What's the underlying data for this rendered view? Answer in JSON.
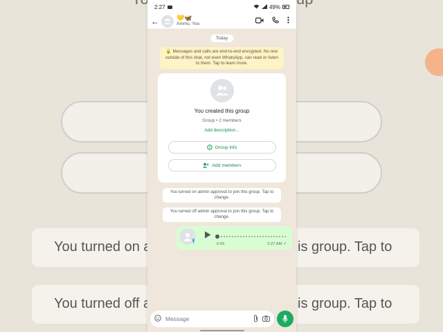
{
  "backdrop": {
    "top_fragment": "You",
    "top_fragment2": "up",
    "line1_left": "You turned on a",
    "line1_right": "is group. Tap to",
    "line2_left": "You turned off a",
    "line2_right": "is group. Tap to"
  },
  "status_bar": {
    "time": "2:27",
    "battery": "49%"
  },
  "header": {
    "title": "💛🦋",
    "subtitle": "Ammu, You"
  },
  "chat": {
    "date_chip": "Today",
    "encryption_note": "🔒 Messages and calls are end-to-end encrypted. No one outside of this chat, not even WhatsApp, can read or listen to them. Tap to learn more.",
    "group_card": {
      "created": "You created this group",
      "members": "Group • 2 members",
      "add_description": "Add description...",
      "group_info_label": "Group info",
      "add_members_label": "Add members"
    },
    "system_notes": [
      "You turned on admin approval to join this group. Tap to change.",
      "You turned off admin approval to join this group. Tap to change."
    ],
    "voice_message": {
      "duration": "0:03",
      "time": "2:27 AM",
      "status": "✓"
    }
  },
  "composer": {
    "placeholder": "Message"
  },
  "colors": {
    "accent": "#1daa61",
    "link": "#128c4a",
    "outgoing_bubble": "#d9fdd3",
    "encryption_bg": "#fdf3c4"
  }
}
